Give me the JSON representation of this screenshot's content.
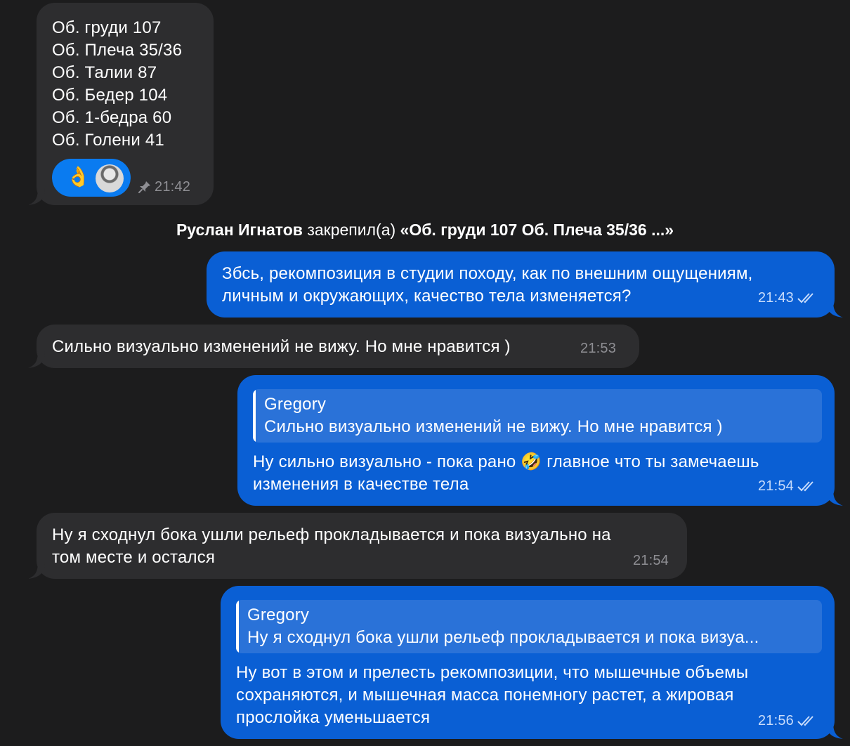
{
  "messages": {
    "m1": {
      "lines": [
        "Об. груди 107",
        "Об. Плеча 35/36",
        "Об. Талии 87",
        "Об. Бедер 104",
        "Об. 1-бедра 60",
        "Об. Голени 41"
      ],
      "reaction_emoji": "👌",
      "time": "21:42"
    },
    "service": {
      "name": "Руслан Игнатов",
      "action": " закрепил(а) ",
      "quote": "«Об. груди 107 Об. Плеча 35/36 ...»"
    },
    "m2": {
      "lines": [
        "Збсь, рекомпозиция в студии походу, как по внешним ощущениям,",
        "личным и окружающих, качество тела изменяется?"
      ],
      "time": "21:43"
    },
    "m3": {
      "text": "Сильно визуально изменений не вижу.  Но мне нравится )",
      "time": "21:53"
    },
    "m4": {
      "reply_name": "Gregory",
      "reply_text": "Сильно визуально изменений не вижу.  Но мне нравится )",
      "line1_a": "Ну сильно визуально - пока рано ",
      "line1_emoji": "🤣",
      "line1_b": " главное что ты замечаешь",
      "line2": "изменения в качестве тела",
      "time": "21:54"
    },
    "m5": {
      "lines": [
        "Ну я сходнул бока ушли рельеф прокладывается и пока визуально на",
        "том месте и остался"
      ],
      "time": "21:54"
    },
    "m6": {
      "reply_name": "Gregory",
      "reply_text": "Ну я сходнул бока ушли рельеф прокладывается и пока визуа...",
      "lines": [
        "Ну вот в этом и прелесть рекомпозиции, что мышечные объемы",
        "сохраняются, и мышечная масса понемногу растет, а жировая",
        "прослойка уменьшается"
      ],
      "time": "21:56"
    }
  },
  "colors": {
    "background": "#1c1c1d",
    "incoming_bubble": "#2d2d2f",
    "outgoing_bubble": "#0a5fd4",
    "reaction_pill": "#0a7bf0"
  },
  "icons": {
    "pin": "pin-icon",
    "read": "double-check-icon"
  }
}
